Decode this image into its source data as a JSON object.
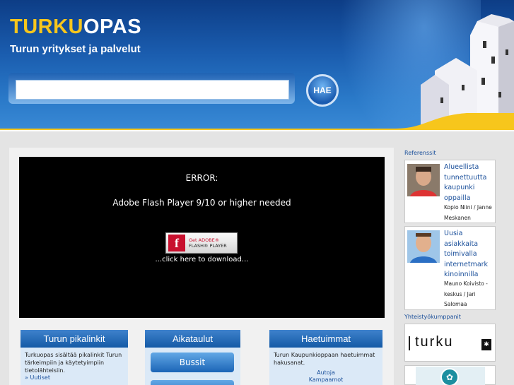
{
  "header": {
    "logo_part1": "TURKU",
    "logo_part2": "OPAS",
    "tagline": "Turun yritykset ja palvelut",
    "search": {
      "value": "",
      "placeholder": ""
    },
    "search_button": "HAE"
  },
  "flash": {
    "error_title": "ERROR:",
    "error_message": "Adobe Flash Player 9/10 or higher needed",
    "badge_line1": "Get ADOBE®",
    "badge_line2": "FLASH® PLAYER",
    "download_text": "...click here to download..."
  },
  "boxes": {
    "pikalinkit": {
      "title": "Turun pikalinkit",
      "text": "Turkuopas sisältää pikalinkit Turun tärkeimpiin ja käytetyimpiin tietolähteisiin.",
      "link": "» Uutiset"
    },
    "aikataulut": {
      "title": "Aikataulut",
      "button1": "Bussit",
      "button2": ""
    },
    "haetuimmat": {
      "title": "Haetuimmat",
      "text": "Turun Kaupunkioppaan haetuimmat hakusanat.",
      "items": [
        "Autoja",
        "Kampaamot"
      ]
    }
  },
  "sidebar": {
    "referenssit_heading": "Referenssit",
    "references": [
      {
        "title": "Alueellista tunnettuutta kaupunki oppailla",
        "name": "Kopio Niini / Janne Meskanen"
      },
      {
        "title": "Uusia asiakkaita toimivalla internetmark kinoinnilla",
        "name": "Mauno Koivisto -keskus / Jari Salomaa"
      }
    ],
    "partners_heading": "Yhteistyökumppanit",
    "partner1_logo_text": "turku"
  },
  "colors": {
    "header_blue": "#1a5cae",
    "logo_yellow": "#f7c61c",
    "box_header_blue": "#145aa6",
    "link_blue": "#1a4f9a"
  }
}
